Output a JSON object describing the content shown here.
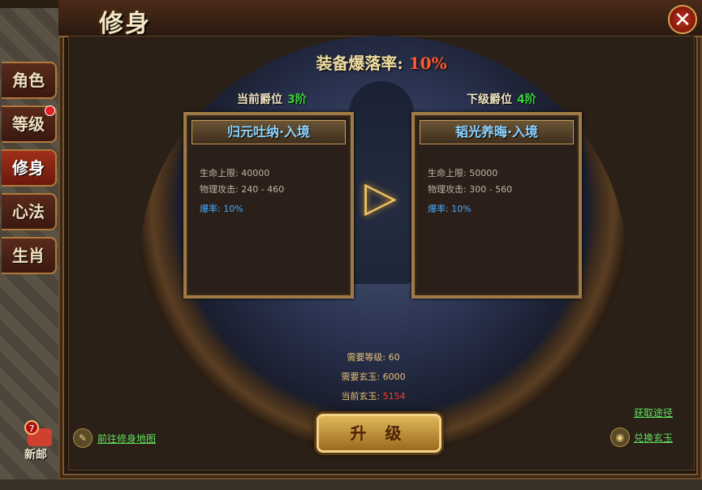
{
  "window": {
    "title": "修身",
    "close_label": "✕"
  },
  "tabs": [
    {
      "label": "角色",
      "active": false,
      "badge": false
    },
    {
      "label": "等级",
      "active": false,
      "badge": true
    },
    {
      "label": "修身",
      "active": true,
      "badge": false
    },
    {
      "label": "心法",
      "active": false,
      "badge": false
    },
    {
      "label": "生肖",
      "active": false,
      "badge": false
    }
  ],
  "drop_rate": {
    "label": "装备爆落率:",
    "value": "10%"
  },
  "current_rank": {
    "label": "当前爵位",
    "value": "3阶"
  },
  "next_rank": {
    "label": "下级爵位",
    "value": "4阶"
  },
  "current_card": {
    "title": "归元吐纳·入境",
    "hp": "生命上限: 40000",
    "attack": "物理攻击: 240 - 460",
    "crit": "爆率: 10%"
  },
  "next_card": {
    "title": "韬光养晦·入境",
    "hp": "生命上限: 50000",
    "attack": "物理攻击: 300 - 560",
    "crit": "爆率: 10%"
  },
  "requirements": {
    "level_label": "需要等级:",
    "level_value": "60",
    "jade_label": "需要玄玉:",
    "jade_value": "6000",
    "current_jade_label": "当前玄玉:",
    "current_jade_value": "5154"
  },
  "upgrade_button": "升 级",
  "links": {
    "goto_map": "前往修身地图",
    "obtain_way": "获取途径",
    "exchange_jade": "兑换玄玉"
  },
  "mail": {
    "count": "7",
    "label": "新邮"
  },
  "colors": {
    "accent_gold": "#e8c060",
    "stat_blue": "#45aaff",
    "rank_green": "#3cd23c",
    "warning_red": "#ff3a2a"
  }
}
